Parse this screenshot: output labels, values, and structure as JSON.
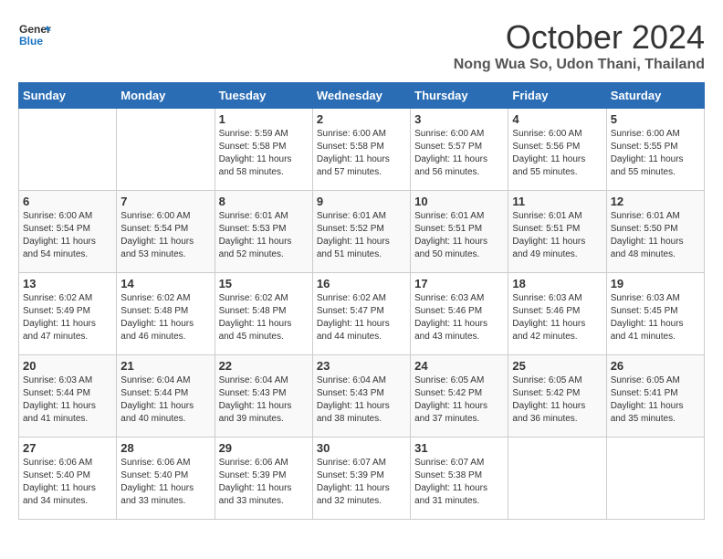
{
  "logo": {
    "line1": "General",
    "line2": "Blue"
  },
  "title": "October 2024",
  "location": "Nong Wua So, Udon Thani, Thailand",
  "days_of_week": [
    "Sunday",
    "Monday",
    "Tuesday",
    "Wednesday",
    "Thursday",
    "Friday",
    "Saturday"
  ],
  "weeks": [
    [
      {
        "day": "",
        "info": ""
      },
      {
        "day": "",
        "info": ""
      },
      {
        "day": "1",
        "info": "Sunrise: 5:59 AM\nSunset: 5:58 PM\nDaylight: 11 hours and 58 minutes."
      },
      {
        "day": "2",
        "info": "Sunrise: 6:00 AM\nSunset: 5:58 PM\nDaylight: 11 hours and 57 minutes."
      },
      {
        "day": "3",
        "info": "Sunrise: 6:00 AM\nSunset: 5:57 PM\nDaylight: 11 hours and 56 minutes."
      },
      {
        "day": "4",
        "info": "Sunrise: 6:00 AM\nSunset: 5:56 PM\nDaylight: 11 hours and 55 minutes."
      },
      {
        "day": "5",
        "info": "Sunrise: 6:00 AM\nSunset: 5:55 PM\nDaylight: 11 hours and 55 minutes."
      }
    ],
    [
      {
        "day": "6",
        "info": "Sunrise: 6:00 AM\nSunset: 5:54 PM\nDaylight: 11 hours and 54 minutes."
      },
      {
        "day": "7",
        "info": "Sunrise: 6:00 AM\nSunset: 5:54 PM\nDaylight: 11 hours and 53 minutes."
      },
      {
        "day": "8",
        "info": "Sunrise: 6:01 AM\nSunset: 5:53 PM\nDaylight: 11 hours and 52 minutes."
      },
      {
        "day": "9",
        "info": "Sunrise: 6:01 AM\nSunset: 5:52 PM\nDaylight: 11 hours and 51 minutes."
      },
      {
        "day": "10",
        "info": "Sunrise: 6:01 AM\nSunset: 5:51 PM\nDaylight: 11 hours and 50 minutes."
      },
      {
        "day": "11",
        "info": "Sunrise: 6:01 AM\nSunset: 5:51 PM\nDaylight: 11 hours and 49 minutes."
      },
      {
        "day": "12",
        "info": "Sunrise: 6:01 AM\nSunset: 5:50 PM\nDaylight: 11 hours and 48 minutes."
      }
    ],
    [
      {
        "day": "13",
        "info": "Sunrise: 6:02 AM\nSunset: 5:49 PM\nDaylight: 11 hours and 47 minutes."
      },
      {
        "day": "14",
        "info": "Sunrise: 6:02 AM\nSunset: 5:48 PM\nDaylight: 11 hours and 46 minutes."
      },
      {
        "day": "15",
        "info": "Sunrise: 6:02 AM\nSunset: 5:48 PM\nDaylight: 11 hours and 45 minutes."
      },
      {
        "day": "16",
        "info": "Sunrise: 6:02 AM\nSunset: 5:47 PM\nDaylight: 11 hours and 44 minutes."
      },
      {
        "day": "17",
        "info": "Sunrise: 6:03 AM\nSunset: 5:46 PM\nDaylight: 11 hours and 43 minutes."
      },
      {
        "day": "18",
        "info": "Sunrise: 6:03 AM\nSunset: 5:46 PM\nDaylight: 11 hours and 42 minutes."
      },
      {
        "day": "19",
        "info": "Sunrise: 6:03 AM\nSunset: 5:45 PM\nDaylight: 11 hours and 41 minutes."
      }
    ],
    [
      {
        "day": "20",
        "info": "Sunrise: 6:03 AM\nSunset: 5:44 PM\nDaylight: 11 hours and 41 minutes."
      },
      {
        "day": "21",
        "info": "Sunrise: 6:04 AM\nSunset: 5:44 PM\nDaylight: 11 hours and 40 minutes."
      },
      {
        "day": "22",
        "info": "Sunrise: 6:04 AM\nSunset: 5:43 PM\nDaylight: 11 hours and 39 minutes."
      },
      {
        "day": "23",
        "info": "Sunrise: 6:04 AM\nSunset: 5:43 PM\nDaylight: 11 hours and 38 minutes."
      },
      {
        "day": "24",
        "info": "Sunrise: 6:05 AM\nSunset: 5:42 PM\nDaylight: 11 hours and 37 minutes."
      },
      {
        "day": "25",
        "info": "Sunrise: 6:05 AM\nSunset: 5:42 PM\nDaylight: 11 hours and 36 minutes."
      },
      {
        "day": "26",
        "info": "Sunrise: 6:05 AM\nSunset: 5:41 PM\nDaylight: 11 hours and 35 minutes."
      }
    ],
    [
      {
        "day": "27",
        "info": "Sunrise: 6:06 AM\nSunset: 5:40 PM\nDaylight: 11 hours and 34 minutes."
      },
      {
        "day": "28",
        "info": "Sunrise: 6:06 AM\nSunset: 5:40 PM\nDaylight: 11 hours and 33 minutes."
      },
      {
        "day": "29",
        "info": "Sunrise: 6:06 AM\nSunset: 5:39 PM\nDaylight: 11 hours and 33 minutes."
      },
      {
        "day": "30",
        "info": "Sunrise: 6:07 AM\nSunset: 5:39 PM\nDaylight: 11 hours and 32 minutes."
      },
      {
        "day": "31",
        "info": "Sunrise: 6:07 AM\nSunset: 5:38 PM\nDaylight: 11 hours and 31 minutes."
      },
      {
        "day": "",
        "info": ""
      },
      {
        "day": "",
        "info": ""
      }
    ]
  ]
}
